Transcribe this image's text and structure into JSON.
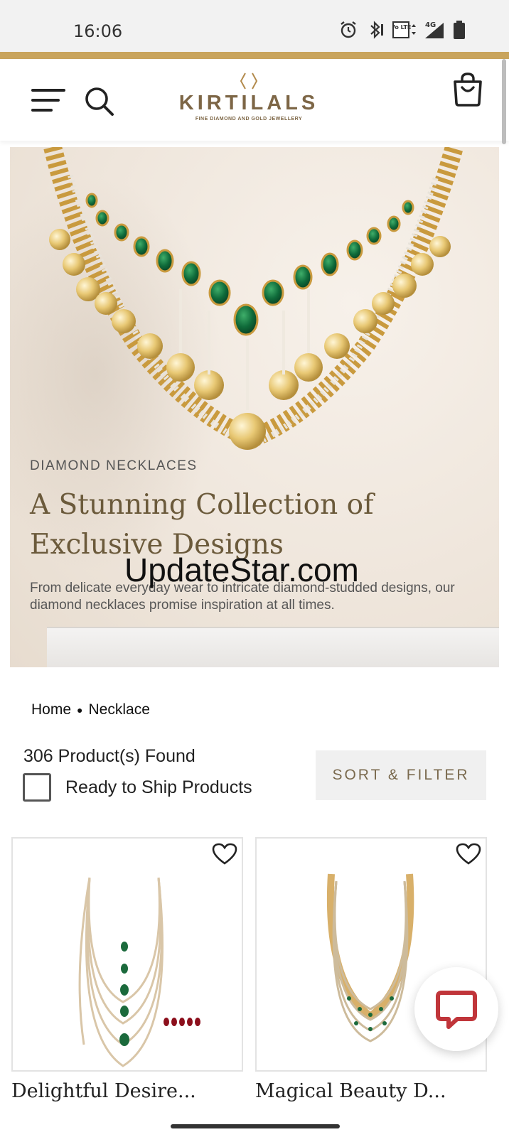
{
  "status_bar": {
    "time": "16:06",
    "icons": [
      "alarm-icon",
      "bluetooth-icon",
      "volte-icon",
      "4g-signal-icon",
      "battery-icon"
    ],
    "network_label": "4G",
    "volte_label": "Vo LTE"
  },
  "header": {
    "brand_name": "KIRTILALS",
    "brand_tagline": "FINE DIAMOND AND GOLD JEWELLERY",
    "accent_color": "#c9a45c",
    "brand_color": "#7d6646"
  },
  "banner": {
    "kicker": "DIAMOND NECKLACES",
    "title": "A Stunning Collection of Exclusive Designs",
    "description": "From delicate everyday wear to intricate diamond-studded designs, our diamond necklaces promise inspiration at all times."
  },
  "watermark": "UpdateStar.com",
  "breadcrumb": {
    "home": "Home",
    "current": "Necklace"
  },
  "listing": {
    "count_text": "306 Product(s) Found",
    "ready_to_ship_label": "Ready to Ship Products",
    "ready_to_ship_checked": false,
    "sort_filter_label": "SORT & FILTER"
  },
  "products": [
    {
      "name": "Delightful Desire..."
    },
    {
      "name": "Magical Beauty D..."
    }
  ]
}
